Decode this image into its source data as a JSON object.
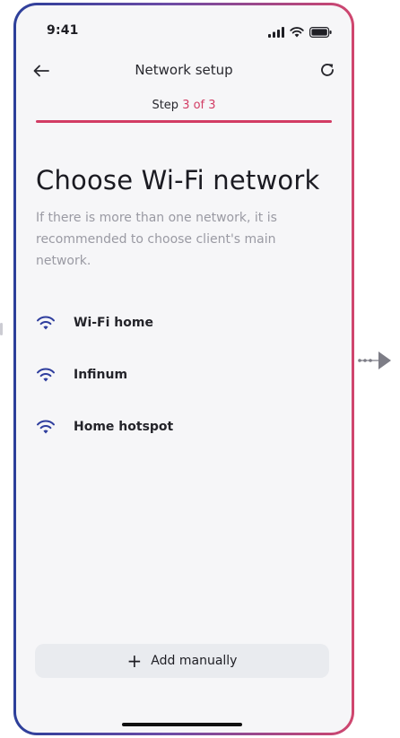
{
  "status_bar": {
    "time": "9:41",
    "icons": [
      "cellular-signal-icon",
      "wifi-status-icon",
      "battery-icon"
    ]
  },
  "header": {
    "back_icon": "arrow-left-icon",
    "title": "Network setup",
    "refresh_icon": "refresh-icon"
  },
  "step": {
    "prefix": "Step",
    "current": "3 of 3",
    "progress_fraction": 1
  },
  "main": {
    "heading": "Choose Wi-Fi network",
    "description": "If there is more than one network, it is recommended to choose client's main network."
  },
  "networks": [
    {
      "name": "Wi-Fi home",
      "icon": "wifi-icon"
    },
    {
      "name": "Infinum",
      "icon": "wifi-icon"
    },
    {
      "name": "Home hotspot",
      "icon": "wifi-icon"
    }
  ],
  "add_manually": {
    "icon": "plus-icon",
    "label": "Add manually"
  },
  "colors": {
    "accent": "#d23c64",
    "wifi_icon": "#2f3e9e",
    "frame_gradient": [
      "#2c3f9a",
      "#6b4ba6",
      "#d0466e"
    ],
    "screen_bg": "#f6f6f8",
    "button_bg": "#e9ebef"
  }
}
